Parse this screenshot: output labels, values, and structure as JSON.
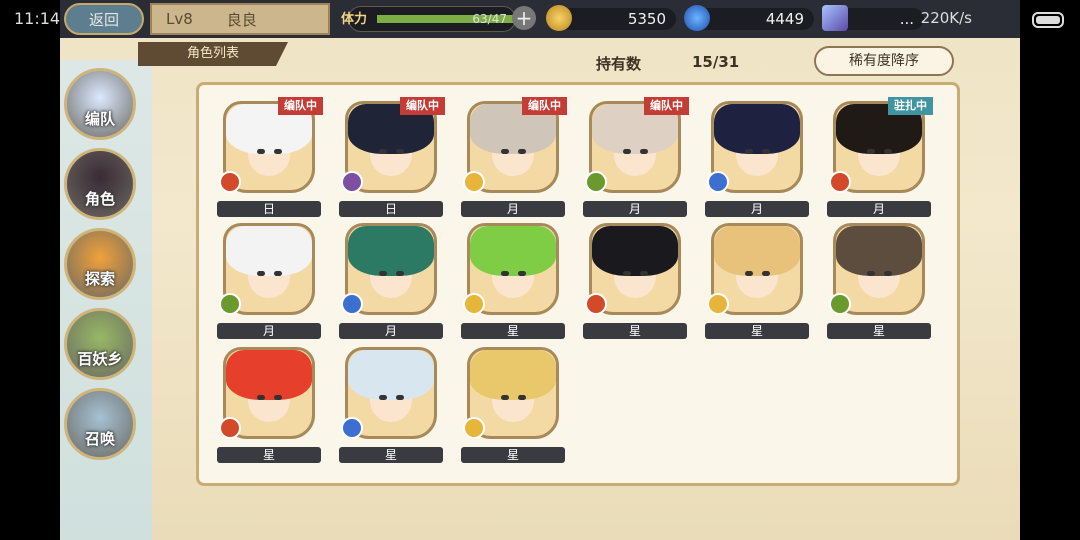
{
  "status_bar": {
    "time": "11:14",
    "net_speed": "220K/s"
  },
  "header": {
    "back_label": "返回",
    "level": "Lv8",
    "player_name": "良良",
    "stamina_label": "体力",
    "stamina_value": "63/47",
    "stamina_fraction": 1.0,
    "gold": "5350",
    "spirit": "4449",
    "gem": "..."
  },
  "page": {
    "title": "角色列表",
    "count_label": "持有数",
    "count_value": "15/31",
    "sort_label": "稀有度降序"
  },
  "sidebar": {
    "items": [
      {
        "label": "编队",
        "icon": "ghost-icon",
        "color": "#dbe8ff"
      },
      {
        "label": "角色",
        "icon": "character-icon",
        "color": "#3a2a34"
      },
      {
        "label": "探索",
        "icon": "compass-icon",
        "color": "#f0a13a"
      },
      {
        "label": "百妖乡",
        "icon": "house-icon",
        "color": "#98b865"
      },
      {
        "label": "召唤",
        "icon": "swirl-icon",
        "color": "#a6c1d4"
      }
    ]
  },
  "roster": [
    {
      "name": "日",
      "tag": "编队中",
      "tag_color": "red",
      "element_color": "#d34a2a",
      "hair": "#f4f4f4"
    },
    {
      "name": "日",
      "tag": "编队中",
      "tag_color": "red",
      "element_color": "#7e4fa0",
      "hair": "#1f2436"
    },
    {
      "name": "月",
      "tag": "编队中",
      "tag_color": "red",
      "element_color": "#e7b53a",
      "hair": "#cfc6b9"
    },
    {
      "name": "月",
      "tag": "编队中",
      "tag_color": "red",
      "element_color": "#6a9a2e",
      "hair": "#ded0c3"
    },
    {
      "name": "月",
      "tag": "",
      "tag_color": "",
      "element_color": "#3c6fd0",
      "hair": "#1e2140"
    },
    {
      "name": "月",
      "tag": "驻扎中",
      "tag_color": "teal",
      "element_color": "#d34a2a",
      "hair": "#201a17"
    },
    {
      "name": "月",
      "tag": "",
      "tag_color": "",
      "element_color": "#6a9a2e",
      "hair": "#f3f3f3"
    },
    {
      "name": "月",
      "tag": "",
      "tag_color": "",
      "element_color": "#3c6fd0",
      "hair": "#2c7a63"
    },
    {
      "name": "星",
      "tag": "",
      "tag_color": "",
      "element_color": "#e7b53a",
      "hair": "#7fcc45"
    },
    {
      "name": "星",
      "tag": "",
      "tag_color": "",
      "element_color": "#d34a2a",
      "hair": "#1a1a1e"
    },
    {
      "name": "星",
      "tag": "",
      "tag_color": "",
      "element_color": "#e7b53a",
      "hair": "#e8c17a"
    },
    {
      "name": "星",
      "tag": "",
      "tag_color": "",
      "element_color": "#6a9a2e",
      "hair": "#5d4d3f"
    },
    {
      "name": "星",
      "tag": "",
      "tag_color": "",
      "element_color": "#d34a2a",
      "hair": "#e6402c"
    },
    {
      "name": "星",
      "tag": "",
      "tag_color": "",
      "element_color": "#3c6fd0",
      "hair": "#d8e7ef"
    },
    {
      "name": "星",
      "tag": "",
      "tag_color": "",
      "element_color": "#e7b53a",
      "hair": "#e9c86c"
    }
  ]
}
